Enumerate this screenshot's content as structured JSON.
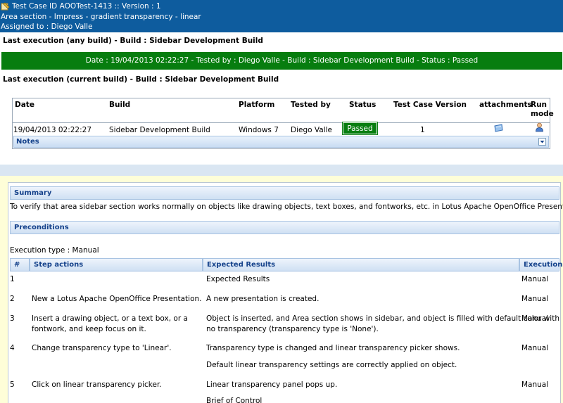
{
  "header": {
    "title": "Test Case ID AOOTest-1413 :: Version : 1",
    "subtitle": "Area section - Impress - gradient transparency - linear",
    "assigned": "Assigned to : Diego Valle"
  },
  "last_any": {
    "title": "Last execution (any build) - Build : Sidebar Development Build",
    "result": "Date : 19/04/2013 02:22:27 - Tested by : Diego Valle - Build : Sidebar Development Build - Status : Passed"
  },
  "last_current": {
    "title": "Last execution (current build) - Build : Sidebar Development Build"
  },
  "exec_table": {
    "headers": {
      "date": "Date",
      "build": "Build",
      "platform": "Platform",
      "tested_by": "Tested by",
      "status": "Status",
      "version": "Test Case Version",
      "attachments": "attachments",
      "run_mode_1": "Run",
      "run_mode_2": "mode"
    },
    "row": {
      "date": "19/04/2013 02:22:27",
      "build": "Sidebar Development Build",
      "platform": "Windows 7",
      "tested_by": "Diego Valle",
      "status": "Passed",
      "version": "1"
    },
    "notes_label": "Notes"
  },
  "spec": {
    "summary_label": "Summary",
    "summary_text": "To verify that area sidebar section works normally on objects like drawing objects, text boxes, and fontworks, etc. in Lotus Apache OpenOffice Presentation.",
    "preconditions_label": "Preconditions",
    "execution_type": "Execution type : Manual",
    "steps_headers": {
      "num": "#",
      "actions": "Step actions",
      "expected": "Expected Results",
      "execution": "Execution"
    },
    "steps": [
      {
        "num": "1",
        "action": "",
        "expected": "Expected Results",
        "exec": "Manual"
      },
      {
        "num": "2",
        "action": "New a Lotus Apache OpenOffice Presentation.",
        "expected": "A new presentation is created.",
        "exec": "Manual"
      },
      {
        "num": "3",
        "action_l1": "Insert a drawing object, or a text box, or a",
        "action_l2": "fontwork, and keep focus on it.",
        "expected_l1": "Object is inserted, and Area section shows in sidebar, and object is filled with default color with",
        "expected_l2": "no transparency (transparency type is 'None').",
        "exec": "Manual"
      },
      {
        "num": "4",
        "action": "Change transparency type to 'Linear'.",
        "expected_l1": "Transparency type is changed and linear transparency picker shows.",
        "expected_l2": "Default linear transparency settings are correctly applied on object.",
        "exec": "Manual"
      },
      {
        "num": "5",
        "action": "Click on linear transparency picker.",
        "expected_l1": "Linear transparency panel pops up.",
        "expected_l2": "Brief of Control",
        "exec": "Manual"
      }
    ]
  },
  "colors": {
    "header_bg": "#0e5c9e",
    "passed_green": "#077d0f",
    "panel_text": "#15428b",
    "spec_bg": "#fefed8"
  },
  "icons": {
    "header": "test-case-icon",
    "attachment": "attachment-icon",
    "run_mode": "manual-run-icon",
    "notes_toggle": "chevron-down-icon"
  }
}
